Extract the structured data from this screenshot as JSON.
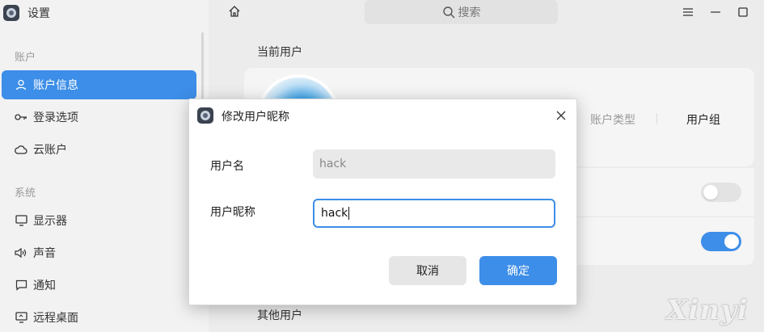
{
  "app": {
    "title": "设置",
    "icon": "settings-gear-icon"
  },
  "sidebar": {
    "sections": [
      {
        "label": "账户"
      },
      {
        "label": "系统"
      }
    ],
    "items": [
      {
        "label": "账户信息",
        "icon": "user-icon",
        "active": true
      },
      {
        "label": "登录选项",
        "icon": "key-icon",
        "active": false
      },
      {
        "label": "云账户",
        "icon": "cloud-icon",
        "active": false
      },
      {
        "label": "显示器",
        "icon": "monitor-icon",
        "active": false
      },
      {
        "label": "声音",
        "icon": "speaker-icon",
        "active": false
      },
      {
        "label": "通知",
        "icon": "chat-bubble-icon",
        "active": false
      },
      {
        "label": "远程桌面",
        "icon": "remote-desktop-icon",
        "active": false
      }
    ]
  },
  "header": {
    "search_placeholder": "搜索"
  },
  "main": {
    "current_user_label": "当前用户",
    "account_type_label": "账户类型",
    "user_group_label": "用户组",
    "other_users_label": "其他用户",
    "toggles": [
      {
        "state": "off"
      },
      {
        "state": "on"
      }
    ]
  },
  "dialog": {
    "title": "修改用户昵称",
    "username_label": "用户名",
    "username_value": "hack",
    "nickname_label": "用户昵称",
    "nickname_value": "hack",
    "cancel_label": "取消",
    "ok_label": "确定"
  },
  "colors": {
    "accent": "#3d8ee8",
    "sidebar_bg": "#f2f2f2",
    "main_bg": "#ececec"
  },
  "watermark": "Xinyi"
}
